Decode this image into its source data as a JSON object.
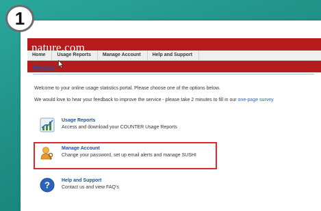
{
  "step_number": "1",
  "app": {
    "logo": "nature.com"
  },
  "nav": {
    "tabs": [
      {
        "label": "Home"
      },
      {
        "label": "Usage Reports"
      },
      {
        "label": "Manage Account"
      },
      {
        "label": "Help and Support"
      }
    ]
  },
  "page": {
    "title": "Home"
  },
  "intro": {
    "welcome": "Welcome to your online usage statistics portal. Please choose one of the options below.",
    "feedback": "We would love to hear your feedback to improve the service - please take 2 minutes to fill in our",
    "survey_link": "one-page survey"
  },
  "options": [
    {
      "title": "Usage Reports",
      "description": "Access and download your COUNTER Usage Reports",
      "icon": "chart-icon"
    },
    {
      "title": "Manage Account",
      "description": "Change your password, set up email alerts and manage SUSHI",
      "icon": "user-key-icon"
    },
    {
      "title": "Help and Support",
      "description": "Contact us and view FAQ's",
      "icon": "help-icon"
    }
  ],
  "colors": {
    "brand": "#b71c1c",
    "highlight": "#e0262a",
    "link": "#1a4f9a"
  }
}
